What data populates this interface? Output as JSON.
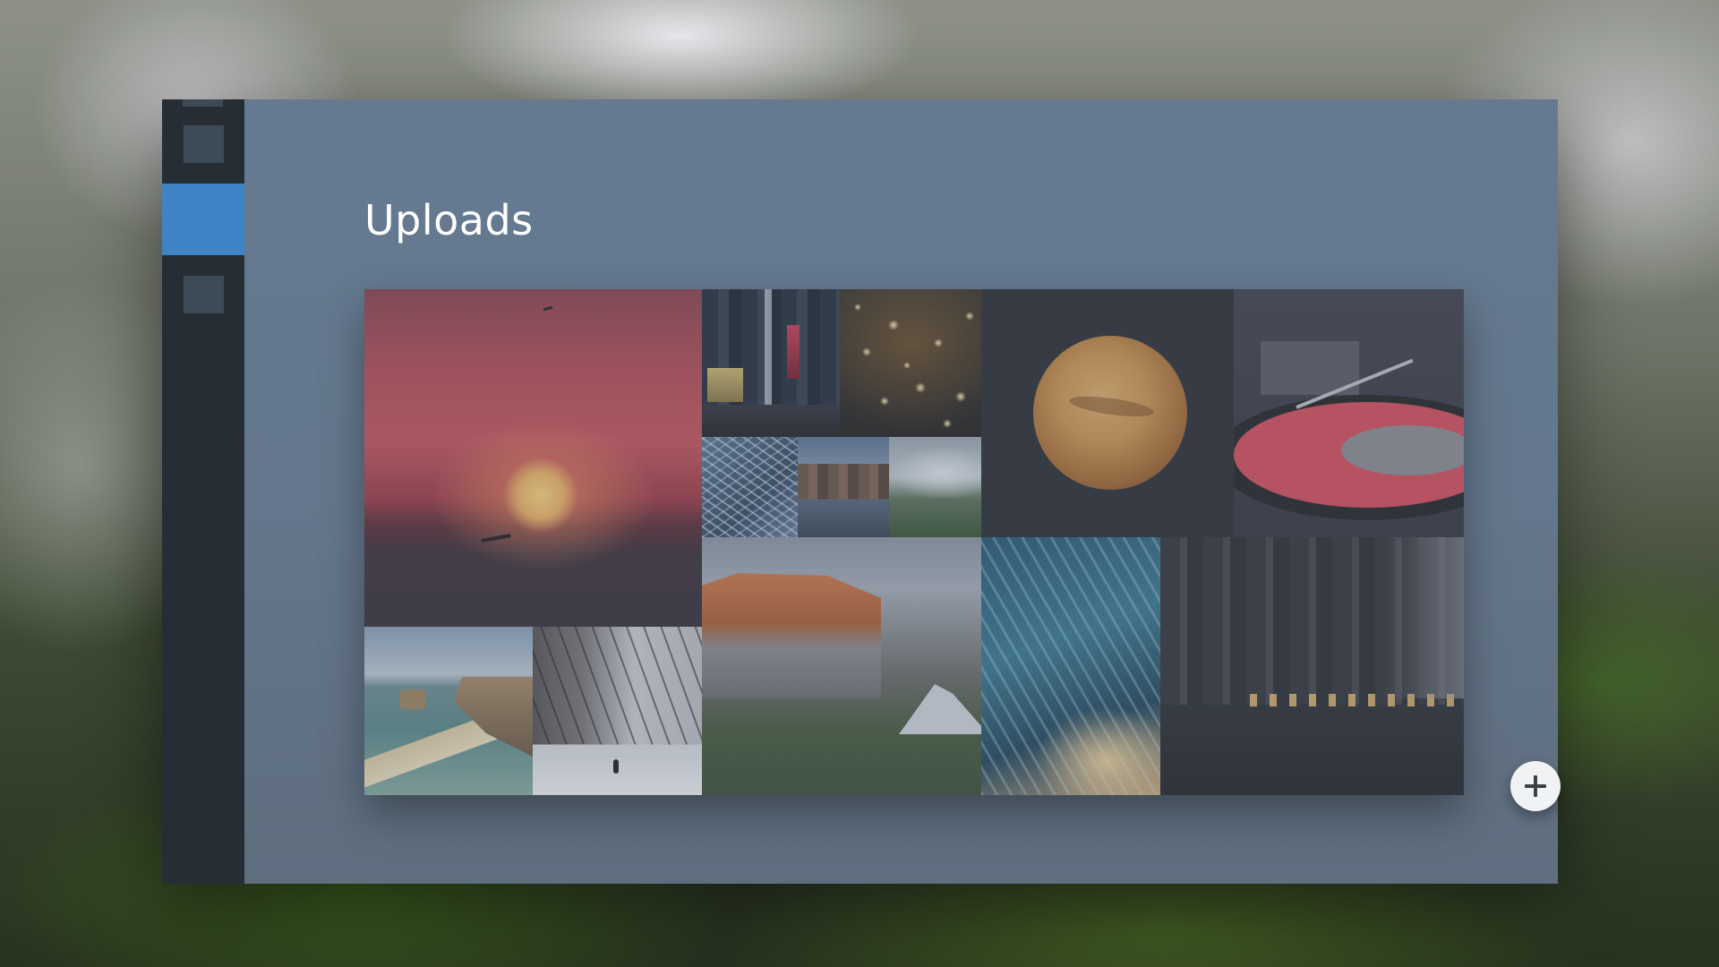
{
  "page": {
    "title": "Uploads"
  },
  "sidebar": {
    "items": [
      {
        "icon": "nav-square-icon",
        "active": false
      },
      {
        "icon": "nav-square-icon",
        "active": true
      },
      {
        "icon": "nav-square-icon",
        "active": false
      }
    ],
    "accent_color": "#3f84c4",
    "background_color": "#262d35"
  },
  "gallery": {
    "photos": [
      {
        "subject": "sunset"
      },
      {
        "subject": "city-street-signs"
      },
      {
        "subject": "hanging-light-bulbs"
      },
      {
        "subject": "pine-branch"
      },
      {
        "subject": "canal-town"
      },
      {
        "subject": "crashing-wave"
      },
      {
        "subject": "mars-planet"
      },
      {
        "subject": "record-turntable"
      },
      {
        "subject": "coastline-cliffs"
      },
      {
        "subject": "snowy-street"
      },
      {
        "subject": "el-capitan"
      },
      {
        "subject": "ocean-wave"
      },
      {
        "subject": "rainy-city-street"
      }
    ]
  },
  "actions": {
    "add_icon": "plus-icon"
  },
  "colors": {
    "main_background": "#657a91",
    "add_button": "#f1f2f4"
  }
}
